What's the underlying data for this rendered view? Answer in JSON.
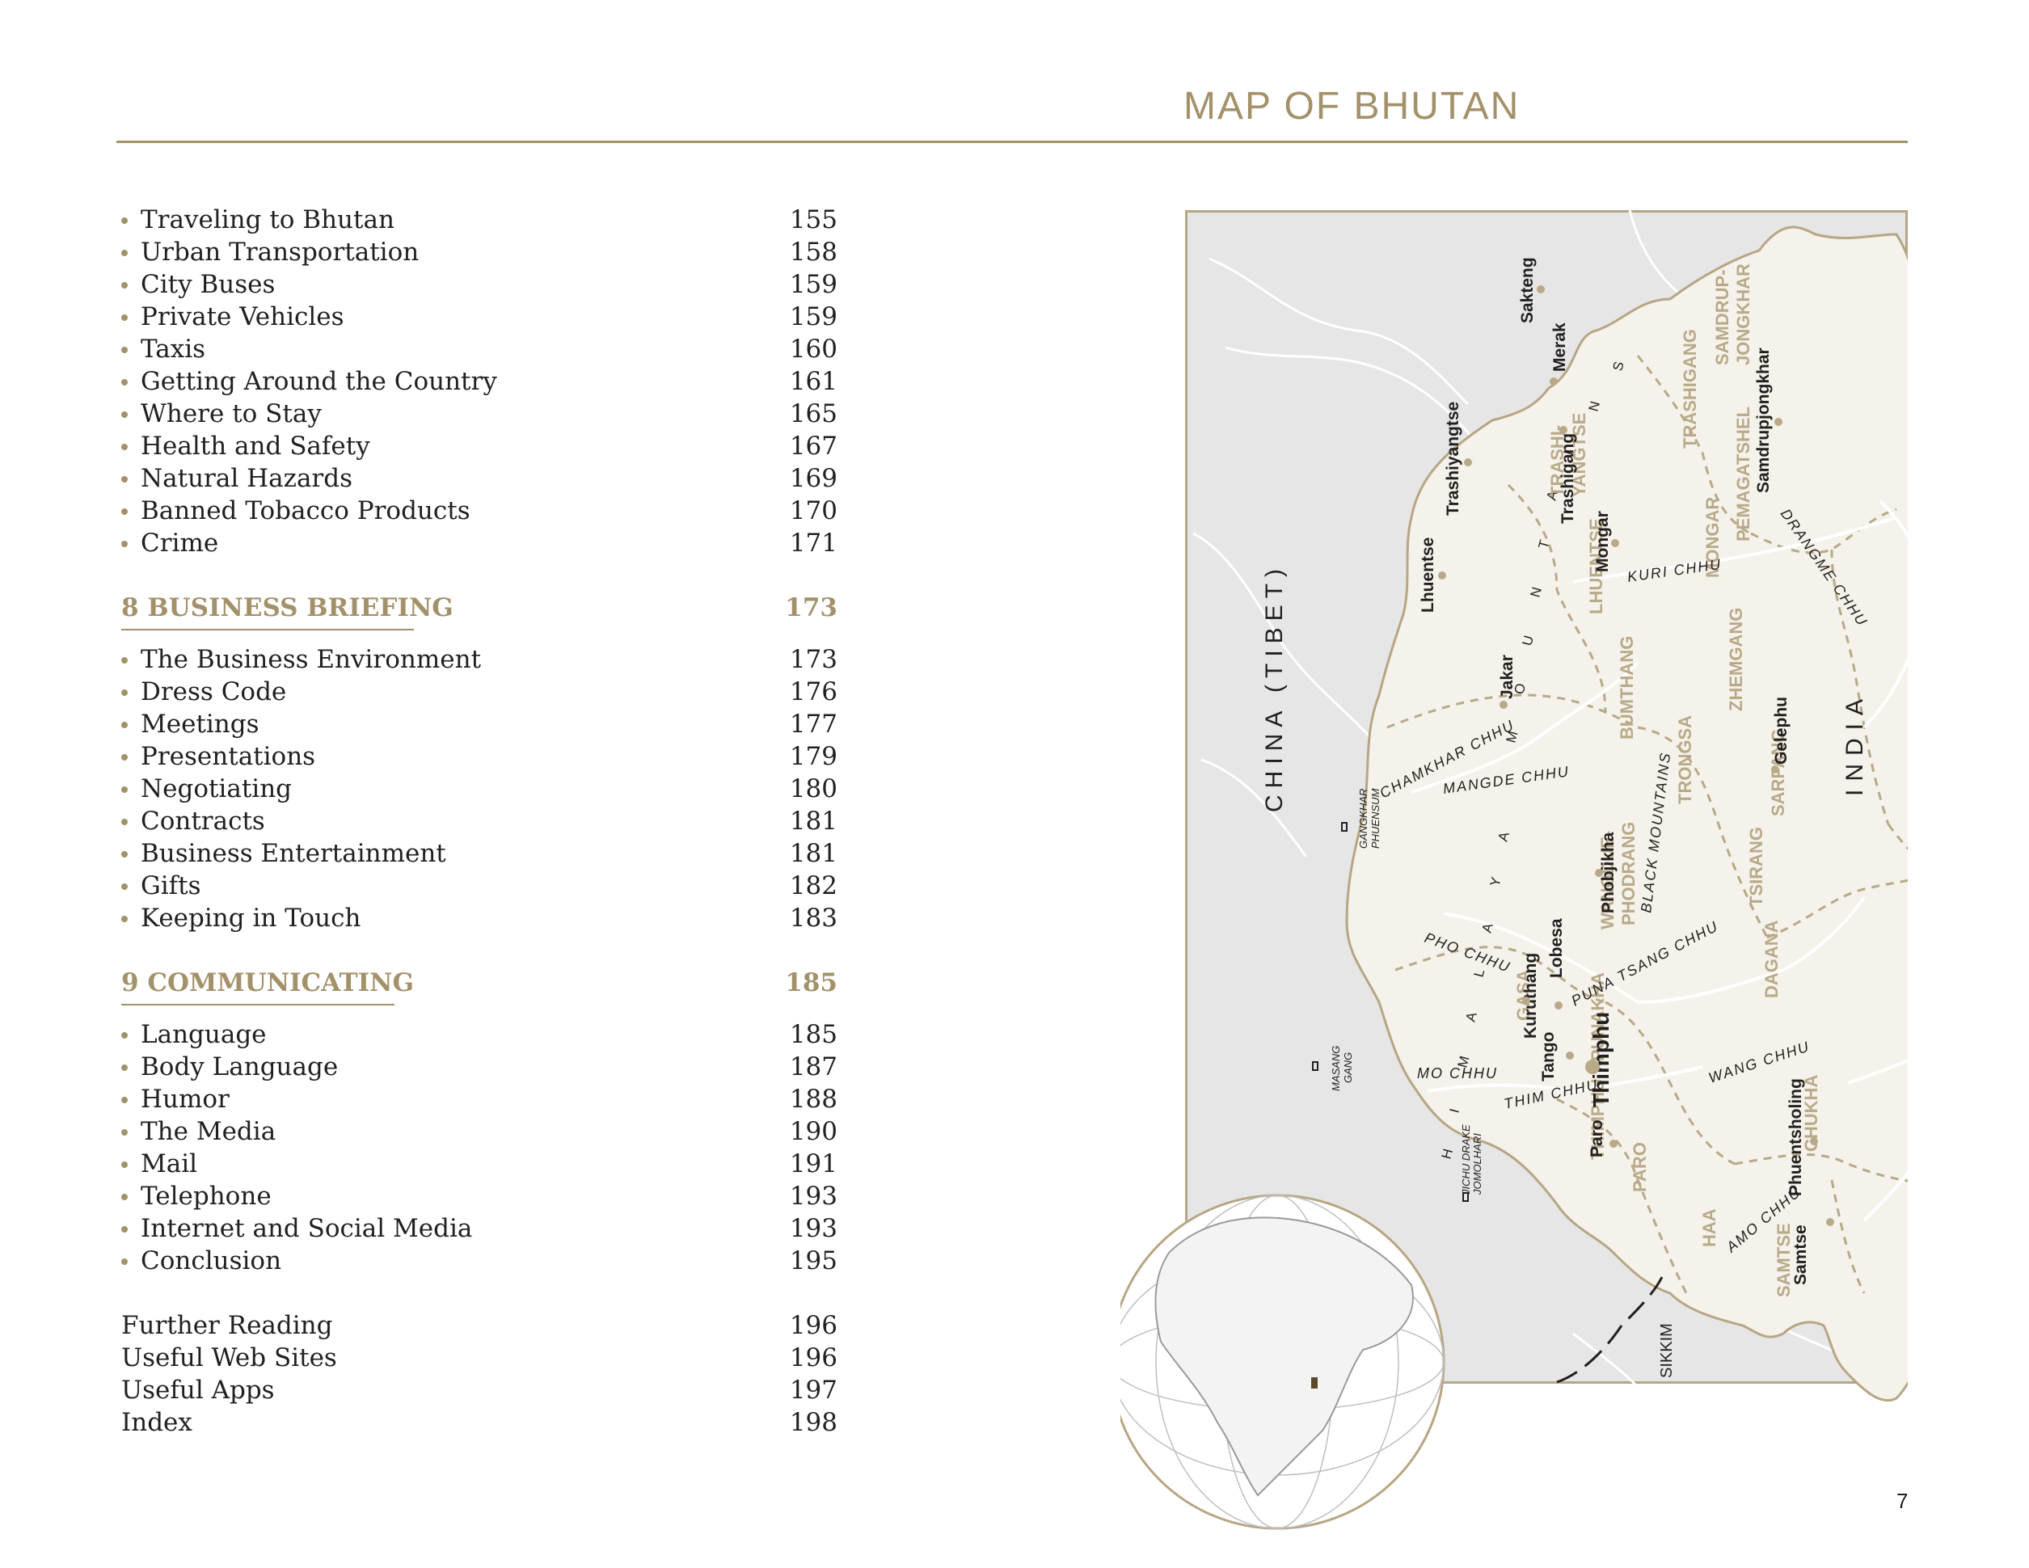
{
  "title": "MAP OF BHUTAN",
  "page_number": "7",
  "toc": {
    "group1": [
      {
        "label": "Traveling to Bhutan",
        "page": "155"
      },
      {
        "label": "Urban Transportation",
        "page": "158"
      },
      {
        "label": "City Buses",
        "page": "159"
      },
      {
        "label": "Private Vehicles",
        "page": "159"
      },
      {
        "label": "Taxis",
        "page": "160"
      },
      {
        "label": "Getting Around the Country",
        "page": "161"
      },
      {
        "label": "Where to Stay",
        "page": "165"
      },
      {
        "label": "Health and Safety",
        "page": "167"
      },
      {
        "label": "Natural Hazards",
        "page": "169"
      },
      {
        "label": "Banned Tobacco Products",
        "page": "170"
      },
      {
        "label": "Crime",
        "page": "171"
      }
    ],
    "section8": {
      "label": "8  BUSINESS BRIEFING",
      "page": "173"
    },
    "group2": [
      {
        "label": "The Business Environment",
        "page": "173"
      },
      {
        "label": "Dress Code",
        "page": "176"
      },
      {
        "label": "Meetings",
        "page": "177"
      },
      {
        "label": "Presentations",
        "page": "179"
      },
      {
        "label": "Negotiating",
        "page": "180"
      },
      {
        "label": "Contracts",
        "page": "181"
      },
      {
        "label": "Business Entertainment",
        "page": "181"
      },
      {
        "label": "Gifts",
        "page": "182"
      },
      {
        "label": "Keeping in Touch",
        "page": "183"
      }
    ],
    "section9": {
      "label": "9  COMMUNICATING",
      "page": "185"
    },
    "group3": [
      {
        "label": "Language",
        "page": "185"
      },
      {
        "label": "Body Language",
        "page": "187"
      },
      {
        "label": "Humor",
        "page": "188"
      },
      {
        "label": "The Media",
        "page": "190"
      },
      {
        "label": "Mail",
        "page": "191"
      },
      {
        "label": "Telephone",
        "page": "193"
      },
      {
        "label": "Internet and Social Media",
        "page": "193"
      },
      {
        "label": "Conclusion",
        "page": "195"
      }
    ],
    "back": [
      {
        "label": "Further Reading",
        "page": "196"
      },
      {
        "label": "Useful Web Sites",
        "page": "196"
      },
      {
        "label": "Useful Apps",
        "page": "197"
      },
      {
        "label": "Index",
        "page": "198"
      }
    ]
  },
  "map": {
    "colors": {
      "land": "#f4f2ea",
      "outside": "#e6e6e6",
      "border": "#b7a684",
      "district": "#b8a988",
      "river": "#ffffff"
    },
    "country_labels": {
      "china": "CHINA (TIBET)",
      "india": "INDIA",
      "sikkim": "SIKKIM"
    },
    "ranges": {
      "himalaya": "H I M A L A Y A   M O U N T A I N S",
      "black": "BLACK MOUNTAINS"
    },
    "districts": [
      "TRASHI-",
      "YANGTSE",
      "LHUENTSE",
      "TRASHIGANG",
      "SAMDRUP-",
      "JONGKHAR",
      "PEMAGATSHEL",
      "MONGAR",
      "BUMTHANG",
      "ZHEMGANG",
      "TRONGSA",
      "SARPANG",
      "WANGDUE-",
      "PHODRANG",
      "TSIRANG",
      "GASA",
      "PUNAKHA",
      "DAGANA",
      "THIMPHU",
      "CHUKHA",
      "PARO",
      "HAA",
      "SAMTSE"
    ],
    "towns": [
      "Sakteng",
      "Merak",
      "Trashiyangtse",
      "Trashigang",
      "Samdrupjongkhar",
      "Lhuentse",
      "Mongar",
      "Jakar",
      "Gelephu",
      "Phobjikha",
      "Kuruthang",
      "Lobesa",
      "Tango",
      "Thimphu",
      "Paro",
      "Phuentsholing",
      "Samtse"
    ],
    "rivers": [
      "KURI CHHU",
      "DRANGME CHHU",
      "CHAMKHAR CHHU",
      "MANGDE CHHU",
      "PHO CHHU",
      "PUNA TSANG CHHU",
      "MO CHHU",
      "THIM CHHU",
      "WANG CHHU",
      "AMO CHHU"
    ],
    "peaks": [
      "GANGKHAR",
      "PHUENSUM",
      "MASANG",
      "GANG",
      "JICHU DRAKE",
      "JOMOLHARI"
    ]
  }
}
